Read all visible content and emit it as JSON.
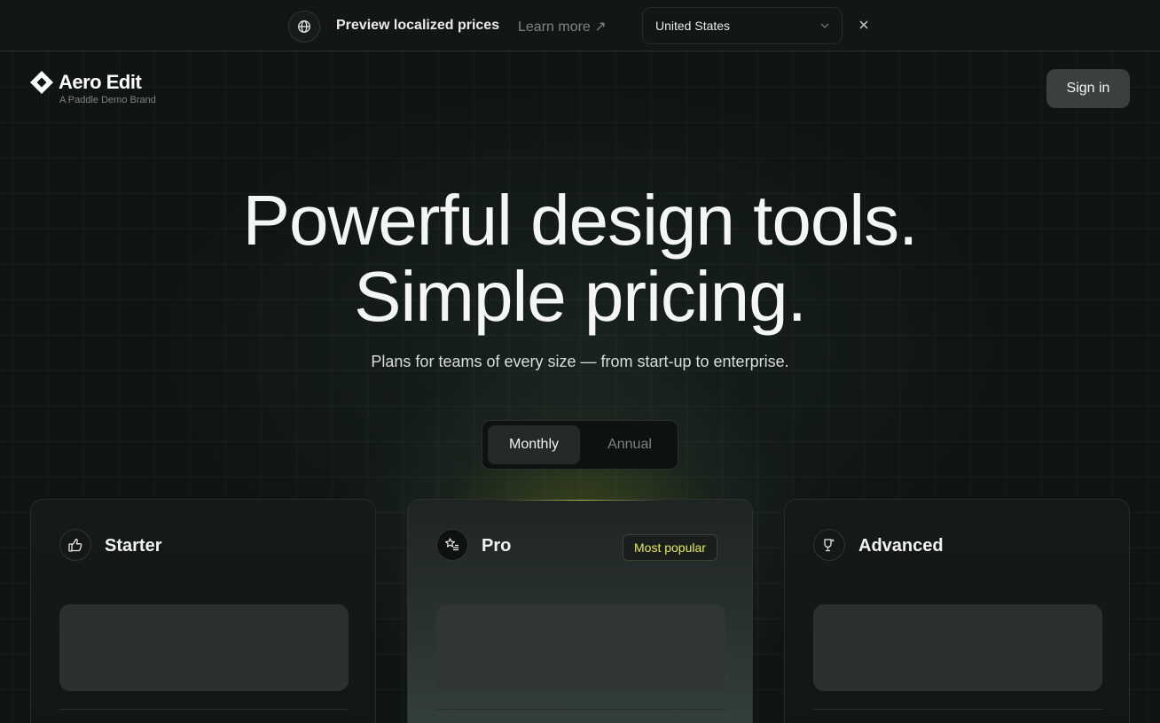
{
  "banner": {
    "icon": "globe-icon",
    "title": "Preview localized prices",
    "learn_more": "Learn more ↗",
    "country": "United States",
    "close_icon": "close-icon"
  },
  "header": {
    "logo_name": "Aero Edit",
    "logo_subtitle": "A Paddle Demo Brand",
    "sign_in": "Sign in"
  },
  "hero": {
    "headline_line1": "Powerful design tools.",
    "headline_line2": "Simple pricing.",
    "subhead": "Plans for teams of every size — from start-up to enterprise."
  },
  "billing_toggle": {
    "options": [
      "Monthly",
      "Annual"
    ],
    "selected": "Monthly"
  },
  "plans": [
    {
      "name": "Starter",
      "icon": "thumbs-up-icon"
    },
    {
      "name": "Pro",
      "icon": "star-list-icon",
      "badge": "Most popular"
    },
    {
      "name": "Advanced",
      "icon": "award-icon"
    }
  ],
  "colors": {
    "background": "#0f1313",
    "accent": "#e5ea5a",
    "button": "#3a403f"
  }
}
